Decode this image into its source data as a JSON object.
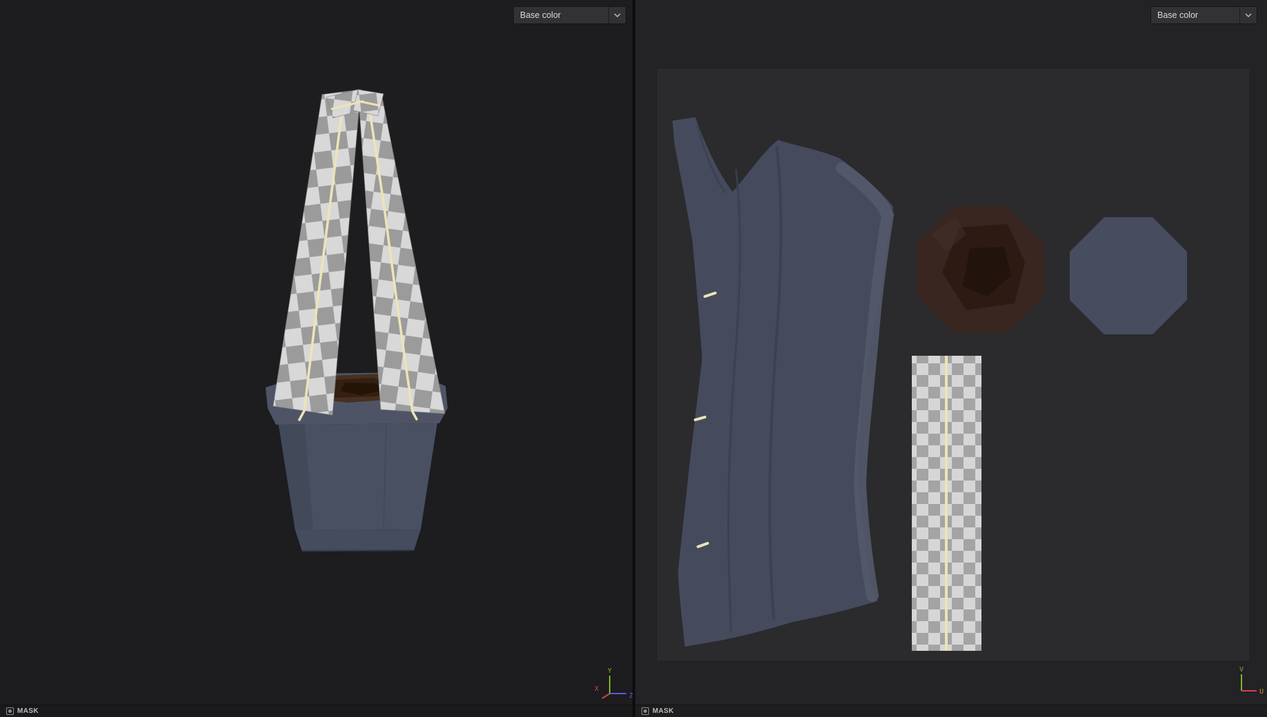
{
  "left_viewport": {
    "channel_dropdown": {
      "value": "Base color"
    },
    "mask_label": "MASK",
    "gizmo": {
      "up": "Y",
      "x": "X",
      "z": "Z"
    }
  },
  "right_viewport": {
    "channel_dropdown": {
      "value": "Base color"
    },
    "mask_label": "MASK",
    "gizmo": {
      "up": "V",
      "right": "U"
    }
  },
  "colors": {
    "left_bg": "#1d1c1e",
    "right_bg": "#232225",
    "uv_area_bg": "#2b2a2d",
    "pot_rim": "#4e5466",
    "pot_body": "#495062",
    "pot_body_shade": "#424959",
    "pot_base": "#454c5d",
    "soil_brown": "#47301f",
    "soil_dark": "#301d10",
    "soil_darker": "#211204",
    "stitch_cream": "#ece4b8",
    "checker_light": "#d8d8d8",
    "checker_dark": "#9b9b9b",
    "uv_checker_light": "#d6d6d6",
    "uv_checker_dark": "#a4a4a4",
    "uv_island_slate": "#454b5d",
    "uv_island_highlight": "#535a6b",
    "uv_island_crease": "#3a4050",
    "uv_octagon_brown": "#392620",
    "uv_octagon_brown_dark": "#2a1912",
    "uv_octagon_brown_darker": "#20120c",
    "uv_octagon_slate": "#474d5f",
    "axis_green": "#76b82a",
    "axis_red": "#d04545",
    "axis_blue": "#5a5adf",
    "axis_orange": "#cc8a33"
  }
}
